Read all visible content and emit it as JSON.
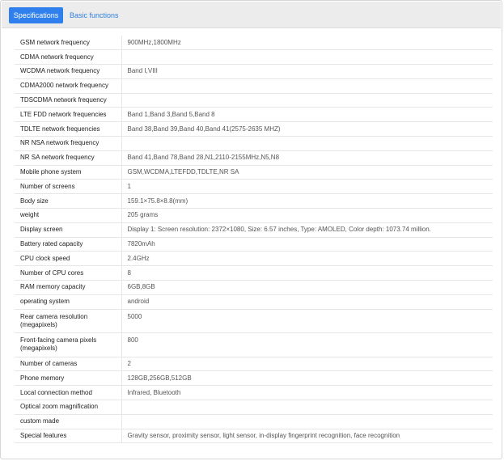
{
  "tabs": [
    {
      "label": "Specifications",
      "active": true
    },
    {
      "label": "Basic functions",
      "active": false
    }
  ],
  "colors": {
    "accent": "#2f80ed",
    "link": "#2f7fe0",
    "tabbar_bg": "#ececec",
    "border": "#e6e6e6"
  },
  "specs": [
    {
      "label": "GSM network frequency",
      "value": "900MHz,1800MHz"
    },
    {
      "label": "CDMA network frequency",
      "value": ""
    },
    {
      "label": "WCDMA network frequency",
      "value": "Band I,VIII"
    },
    {
      "label": "CDMA2000 network frequency",
      "value": ""
    },
    {
      "label": "TDSCDMA network frequency",
      "value": ""
    },
    {
      "label": "LTE FDD network frequencies",
      "value": "Band 1,Band 3,Band 5,Band 8"
    },
    {
      "label": "TDLTE network frequencies",
      "value": "Band 38,Band 39,Band 40,Band 41(2575-2635 MHZ)"
    },
    {
      "label": "NR NSA network frequency",
      "value": ""
    },
    {
      "label": "NR SA network frequency",
      "value": "Band 41,Band 78,Band 28,N1,2110-2155MHz,N5,N8"
    },
    {
      "label": "Mobile phone system",
      "value": "GSM,WCDMA,LTEFDD,TDLTE,NR SA"
    },
    {
      "label": "Number of screens",
      "value": "1"
    },
    {
      "label": "Body size",
      "value": "159.1×75.8×8.8(mm)"
    },
    {
      "label": "weight",
      "value": "205 grams"
    },
    {
      "label": "Display screen",
      "value": "Display 1: Screen resolution: 2372×1080, Size: 6.57 inches, Type: AMOLED, Color depth: 1073.74 million."
    },
    {
      "label": "Battery rated capacity",
      "value": "7820mAh"
    },
    {
      "label": "CPU clock speed",
      "value": "2.4GHz"
    },
    {
      "label": "Number of CPU cores",
      "value": "8"
    },
    {
      "label": "RAM memory capacity",
      "value": "6GB,8GB"
    },
    {
      "label": "operating system",
      "value": "android"
    },
    {
      "label": "Rear camera resolution (megapixels)",
      "value": "5000"
    },
    {
      "label": "Front-facing camera pixels (megapixels)",
      "value": "800"
    },
    {
      "label": "Number of cameras",
      "value": "2"
    },
    {
      "label": "Phone memory",
      "value": "128GB,256GB,512GB"
    },
    {
      "label": "Local connection method",
      "value": "Infrared, Bluetooth"
    },
    {
      "label": "Optical zoom magnification",
      "value": ""
    },
    {
      "label": "custom made",
      "value": ""
    },
    {
      "label": "Special features",
      "value": "Gravity sensor, proximity sensor, light sensor, in-display fingerprint recognition, face recognition"
    }
  ]
}
